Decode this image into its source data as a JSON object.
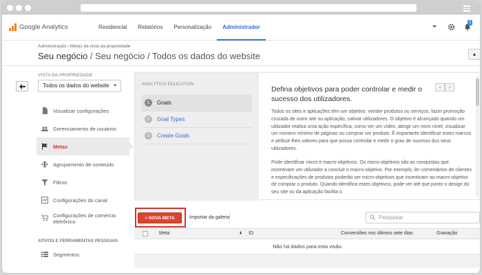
{
  "header": {
    "logo_text": "Google Analytics",
    "nav": [
      {
        "label": "Residencial"
      },
      {
        "label": "Relatórios"
      },
      {
        "label": "Personalização"
      },
      {
        "label": "Administrador"
      }
    ],
    "active_nav": "Administrador",
    "notification_count": "1",
    "icons": [
      "chevron-down-icon",
      "gear-icon",
      "bell-icon"
    ]
  },
  "breadcrumb": {
    "items": [
      "Administração",
      "Metas da vista da propriedade"
    ]
  },
  "title": {
    "primary": "Seu negócio",
    "rest": " / Seu negócio / Todos os dados do website"
  },
  "sidebar": {
    "view_label": "VISTA DA PROPRIEDADE",
    "view_value": "Todos os dados do website",
    "items": [
      {
        "label": "Visualizar configurações",
        "icon": "document-icon"
      },
      {
        "label": "Gerenciamento de usuários",
        "icon": "users-icon"
      },
      {
        "label": "Metas",
        "icon": "flag-icon"
      },
      {
        "label": "Agrupamento de conteúdo",
        "icon": "grouping-icon"
      },
      {
        "label": "Filtros",
        "icon": "filter-icon"
      },
      {
        "label": "Configurações do canal",
        "icon": "channel-icon"
      },
      {
        "label": "Configurações de comércio eletrônico",
        "icon": "cart-icon"
      }
    ],
    "active_item": "Metas",
    "section_label": "ATIVOS E FERRAMENTAS PESSOAIS",
    "segments_label": "Segmentos"
  },
  "education": {
    "header": "ANALYTICS EDUCATION",
    "steps": [
      {
        "num": "1",
        "label": "Goals"
      },
      {
        "num": "2",
        "label": "Goal Types"
      },
      {
        "num": "3",
        "label": "Create Goals"
      }
    ],
    "title": "Defina objetivos para poder controlar e medir o sucesso dos utilizadores.",
    "paragraph1": "Todos os sites e aplicações têm um objetivo: vender produtos ou serviços, fazer promoção cruzada de outro site ou aplicação, cativar utilizadores. O objetivo é alcançado quando um utilizador realiza uma ação específica, como ver um vídeo, atingir um novo nível, visualizar um número mínimo de páginas ou comprar um produto. É importante identificar estes marcos e atribuir-lhes valores para que possa controlar e medir o grau de sucesso dos seus utilizadores.",
    "paragraph2": "Pode identificar micro e macro-objetivos. Os micro-objetivos são as conquistas que incentivam um utilizador a concluir o macro-objetivo. Por exemplo, ler comentários de clientes e especificações de produtos poderão ser micro-objetivos que incentivam ao macro-objetivo de comprar o produto. Quando identifica estes objetivos, pode ver até que ponto o design do seu site ou da aplicação facilita o"
  },
  "toolbar": {
    "new_goal": "+ NOVA META",
    "import": "Importar da galeria",
    "search_placeholder": "Pesquisar"
  },
  "table": {
    "columns": [
      "Meta",
      "ID",
      "Conversões nos últimos sete dias",
      "Gravação"
    ],
    "empty_message": "Não há dados para esta visão."
  }
}
